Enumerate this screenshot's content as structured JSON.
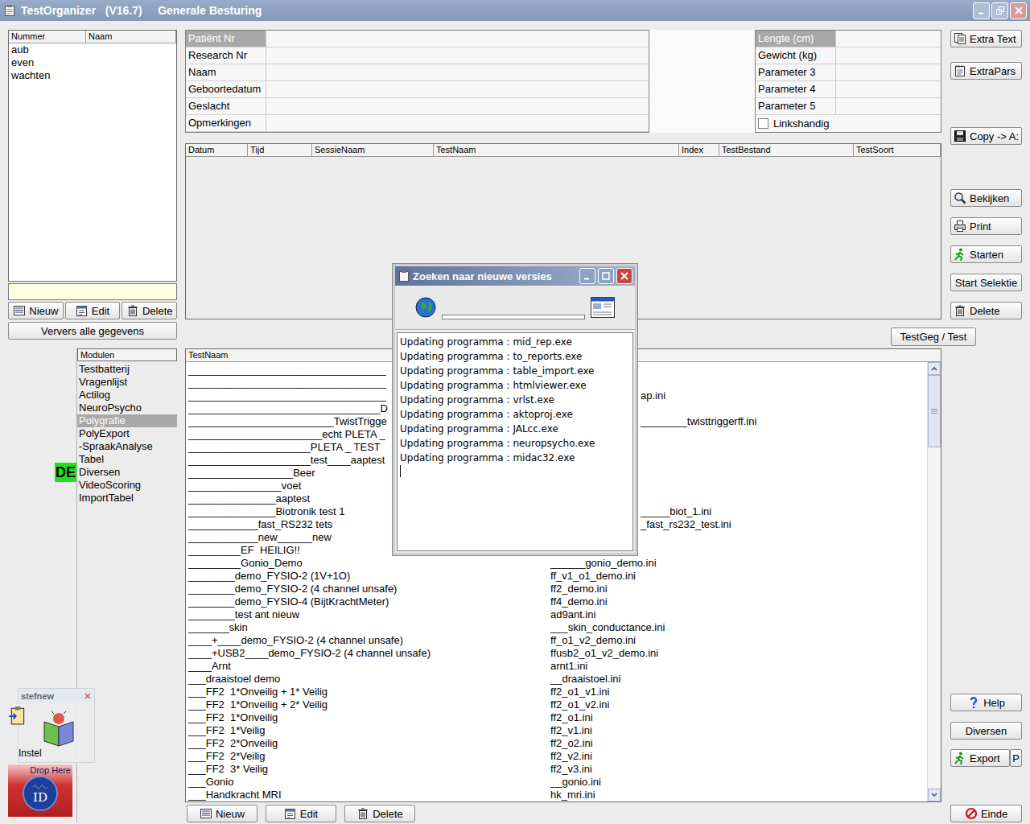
{
  "window": {
    "title": "TestOrganizer   (V16.7)     Generale Besturing"
  },
  "people": {
    "columns": [
      "Nummer",
      "Naam"
    ],
    "rows": [
      "aub",
      "even",
      "wachten"
    ],
    "search": {
      "value": ""
    },
    "buttons": [
      "Nieuw",
      "Edit",
      "Delete"
    ],
    "refresh": "Ververs alle gegevens"
  },
  "patient_fields": [
    {
      "label": "Patiënt Nr",
      "value": "",
      "selected": true
    },
    {
      "label": "Research Nr",
      "value": "",
      "selected": false
    },
    {
      "label": "Naam",
      "value": "",
      "selected": false
    },
    {
      "label": "Geboortedatum",
      "value": "",
      "selected": false
    },
    {
      "label": "Geslacht",
      "value": "",
      "selected": false
    },
    {
      "label": "Opmerkingen",
      "value": "",
      "selected": false
    }
  ],
  "parameters": [
    {
      "label": "Lengte (cm)",
      "value": "",
      "selected": true
    },
    {
      "label": "Gewicht (kg)",
      "value": "",
      "selected": false
    },
    {
      "label": "Parameter 3",
      "value": "",
      "selected": false
    },
    {
      "label": "Parameter 4",
      "value": "",
      "selected": false
    },
    {
      "label": "Parameter 5",
      "value": "",
      "selected": false
    }
  ],
  "left_handed": {
    "label": "Linkshandig",
    "checked": false
  },
  "sessions": {
    "columns": [
      "Datum",
      "Tijd",
      "SessieNaam",
      "TestNaam",
      "Index",
      "TestBestand",
      "TestSoort"
    ],
    "rows": []
  },
  "testgeg_button": "TestGeg / Test",
  "modules": {
    "header": "Modulen",
    "items": [
      {
        "label": "Testbatterij",
        "selected": false
      },
      {
        "label": "Vragenlijst",
        "selected": false
      },
      {
        "label": "Actilog",
        "selected": false
      },
      {
        "label": "NeuroPsycho",
        "selected": false
      },
      {
        "label": "Polygrafie",
        "selected": true
      },
      {
        "label": "PolyExport",
        "selected": false
      },
      {
        "label": "-SpraakAnalyse",
        "selected": false
      },
      {
        "label": "Tabel",
        "selected": false
      },
      {
        "label": "Diversen",
        "selected": false
      },
      {
        "label": "VideoScoring",
        "selected": false
      },
      {
        "label": "ImportTabel",
        "selected": false
      }
    ]
  },
  "badge": {
    "text": "DE"
  },
  "tests": {
    "header": "TestNaam",
    "scrollbar": {
      "level": 0
    },
    "rows": [
      {
        "name": "__________________________________",
        "file": "",
        "kind": "covered"
      },
      {
        "name": "__________________________________",
        "file": "",
        "kind": "covered"
      },
      {
        "name": "__________________________________",
        "file": "ap.ini",
        "kind": "covered"
      },
      {
        "name": "_________________________________D",
        "file": "",
        "kind": "covered"
      },
      {
        "name": "_________________________TwistTrigge",
        "file": "________twisttriggerff.ini",
        "kind": "covered"
      },
      {
        "name": "_______________________echt PLETA _",
        "file": "",
        "kind": "covered"
      },
      {
        "name": "_____________________PLETA _ TEST",
        "file": "",
        "kind": "covered"
      },
      {
        "name": "_____________________test____aaptest",
        "file": "",
        "kind": "covered"
      },
      {
        "name": "__________________Beer",
        "file": "",
        "kind": "covered"
      },
      {
        "name": "________________voet",
        "file": "",
        "kind": "covered"
      },
      {
        "name": "_______________aaptest",
        "file": "",
        "kind": "covered"
      },
      {
        "name": "_______________Biotronik test 1",
        "file": "_____biot_1.ini",
        "kind": "covered"
      },
      {
        "name": "____________fast_RS232 tets",
        "file": "_fast_rs232_test.ini",
        "kind": "covered"
      },
      {
        "name": "____________new______new",
        "file": "",
        "kind": "covered"
      },
      {
        "name": "_________EF  HEILIG!!",
        "file": "",
        "kind": "covered"
      },
      {
        "name": "_________Gonio_Demo",
        "file": "______gonio_demo.ini",
        "kind": "full"
      },
      {
        "name": "________demo_FYSIO-2 (1V+1O)",
        "file": "ff_v1_o1_demo.ini",
        "kind": "full"
      },
      {
        "name": "________demo_FYSIO-2 (4 channel unsafe)",
        "file": "ff2_demo.ini",
        "kind": "full"
      },
      {
        "name": "________demo_FYSIO-4 (BijtKrachtMeter)",
        "file": "ff4_demo.ini",
        "kind": "full"
      },
      {
        "name": "________test ant nieuw",
        "file": "ad9ant.ini",
        "kind": "full"
      },
      {
        "name": "_______skin",
        "file": "___skin_conductance.ini",
        "kind": "full"
      },
      {
        "name": "____+____demo_FYSIO-2 (4 channel unsafe)",
        "file": "ff_o1_v2_demo.ini",
        "kind": "full"
      },
      {
        "name": "____+USB2____demo_FYSIO-2 (4 channel unsafe)",
        "file": "ffusb2_o1_v2_demo.ini",
        "kind": "full"
      },
      {
        "name": "____Arnt",
        "file": "arnt1.ini",
        "kind": "full"
      },
      {
        "name": "___draaistoel demo",
        "file": "__draaistoel.ini",
        "kind": "full"
      },
      {
        "name": "___FF2  1*Onveilig + 1* Veilig",
        "file": "ff2_o1_v1.ini",
        "kind": "full"
      },
      {
        "name": "___FF2  1*Onveilig + 2* Veilig",
        "file": "ff2_o1_v2.ini",
        "kind": "full"
      },
      {
        "name": "___FF2  1*Onveilig",
        "file": "ff2_o1.ini",
        "kind": "full"
      },
      {
        "name": "___FF2  1*Veilig",
        "file": "ff2_v1.ini",
        "kind": "full"
      },
      {
        "name": "___FF2  2*Onveilig",
        "file": "ff2_o2.ini",
        "kind": "full"
      },
      {
        "name": "___FF2  2*Veilig",
        "file": "ff2_v2.ini",
        "kind": "full"
      },
      {
        "name": "___FF2  3* Veilig",
        "file": "ff2_v3.ini",
        "kind": "full"
      },
      {
        "name": "___Gonio",
        "file": "__gonio.ini",
        "kind": "full"
      },
      {
        "name": "___Handkracht MRI",
        "file": "hk_mri.ini",
        "kind": "full"
      }
    ],
    "buttons": [
      "Nieuw",
      "Edit",
      "Delete"
    ]
  },
  "side_buttons": {
    "top": [
      "Extra Text",
      "ExtraPars",
      "Copy -> A:",
      "Bekijken",
      "Print",
      "Starten",
      "Start Selektie",
      "Delete"
    ],
    "bottom": [
      "Help",
      "Diversen",
      "Export",
      "P",
      "Einde"
    ]
  },
  "dialog": {
    "title": "Zoeken naar nieuwe versies",
    "progress": {
      "level": 0
    },
    "log": [
      "Updating programma : mid_rep.exe",
      "Updating programma : to_reports.exe",
      "Updating programma : table_import.exe",
      "Updating programma : htmlviewer.exe",
      "Updating programma : vrlst.exe",
      "Updating programma : aktoproj.exe",
      "Updating programma : JALcc.exe",
      "Updating programma : neuropsycho.exe",
      "Updating programma : midac32.exe"
    ]
  },
  "launcher": {
    "title": "stefnew",
    "item": "Instel"
  },
  "drop_zone": {
    "label": "Drop Here",
    "logo": "ID"
  }
}
